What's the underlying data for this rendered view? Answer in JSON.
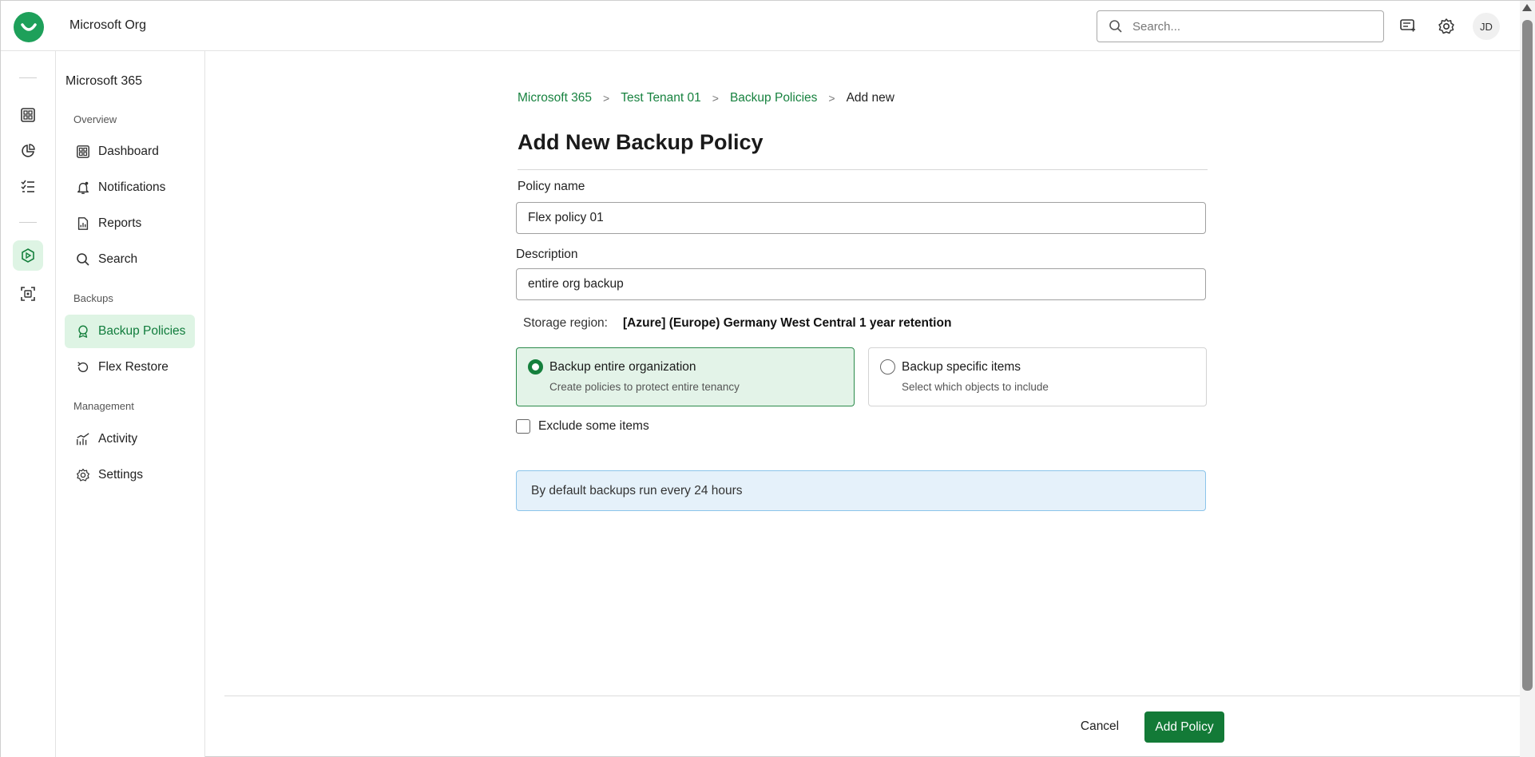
{
  "header": {
    "org_name": "Microsoft Org",
    "search_placeholder": "Search...",
    "avatar_initials": "JD"
  },
  "rail": {
    "icons": [
      "dashboard-icon",
      "reports-icon",
      "checklist-icon",
      "backup-icon",
      "scan-icon"
    ],
    "active": "backup-icon"
  },
  "sidenav": {
    "title": "Microsoft 365",
    "sections": [
      {
        "label": "Overview",
        "items": [
          {
            "label": "Dashboard",
            "icon": "dashboard-icon"
          },
          {
            "label": "Notifications",
            "icon": "bell-icon"
          },
          {
            "label": "Reports",
            "icon": "report-icon"
          },
          {
            "label": "Search",
            "icon": "search-icon"
          }
        ]
      },
      {
        "label": "Backups",
        "items": [
          {
            "label": "Backup Policies",
            "icon": "ribbon-icon",
            "active": true
          },
          {
            "label": "Flex Restore",
            "icon": "restore-icon"
          }
        ]
      },
      {
        "label": "Management",
        "items": [
          {
            "label": "Activity",
            "icon": "activity-icon"
          },
          {
            "label": "Settings",
            "icon": "gear-icon"
          }
        ]
      }
    ]
  },
  "breadcrumb": {
    "items": [
      "Microsoft 365",
      "Test Tenant 01",
      "Backup Policies"
    ],
    "current": "Add new"
  },
  "page": {
    "title": "Add New Backup Policy"
  },
  "form": {
    "policy_name_label": "Policy name",
    "policy_name_value": "Flex policy 01",
    "description_label": "Description",
    "description_value": "entire org backup",
    "storage_label": "Storage region:",
    "storage_value": "[Azure] (Europe) Germany West Central 1 year retention",
    "options": [
      {
        "title": "Backup entire organization",
        "subtitle": "Create policies to protect entire tenancy",
        "selected": true
      },
      {
        "title": "Backup specific items",
        "subtitle": "Select which objects to include",
        "selected": false
      }
    ],
    "exclude_label": "Exclude some items",
    "exclude_checked": false,
    "info_text": "By default backups run every 24 hours"
  },
  "footer": {
    "cancel_label": "Cancel",
    "add_label": "Add Policy"
  },
  "colors": {
    "accent": "#137a37",
    "link": "#17823f",
    "active_bg": "#def4e4",
    "info_bg": "#e5f1fa",
    "info_border": "#8bc4ea"
  }
}
